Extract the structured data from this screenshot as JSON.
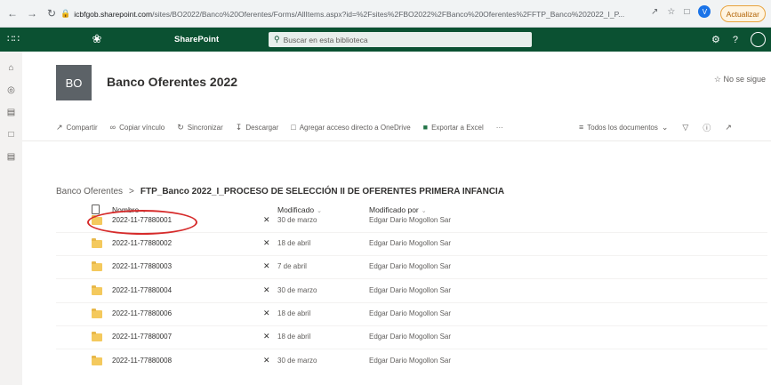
{
  "browser": {
    "url_host": "icbfgob.sharepoint.com",
    "url_path": "/sites/BO2022/Banco%20Oferentes/Forms/AllItems.aspx?id=%2Fsites%2FBO2022%2FBanco%20Oferentes%2FFTP_Banco%202022_I_P...",
    "profile_initial": "V",
    "update_label": "Actualizar"
  },
  "suite": {
    "app_name": "SharePoint",
    "search_placeholder": "Buscar en esta biblioteca",
    "help_label": "?"
  },
  "site": {
    "logo_text": "BO",
    "title": "Banco Oferentes 2022",
    "follow_label": "No se sigue"
  },
  "commands": {
    "share": "Compartir",
    "copy_link": "Copiar vínculo",
    "sync": "Sincronizar",
    "download": "Descargar",
    "add_shortcut": "Agregar acceso directo a OneDrive",
    "export_excel": "Exportar a Excel",
    "more": "···",
    "view_name": "Todos los documentos"
  },
  "breadcrumb": {
    "parent": "Banco Oferentes",
    "separator": ">",
    "current": "FTP_Banco 2022_I_PROCESO DE SELECCIÓN II DE OFERENTES PRIMERA INFANCIA"
  },
  "table": {
    "columns": {
      "name": "Nombre",
      "modified": "Modificado",
      "modified_by": "Modificado por"
    },
    "rows": [
      {
        "name": "2022-11-77880001",
        "modified": "30 de marzo",
        "modified_by": "Edgar Dario Mogollon Sar"
      },
      {
        "name": "2022-11-77880002",
        "modified": "18 de abril",
        "modified_by": "Edgar Dario Mogollon Sar"
      },
      {
        "name": "2022-11-77880003",
        "modified": "7 de abril",
        "modified_by": "Edgar Dario Mogollon Sar"
      },
      {
        "name": "2022-11-77880004",
        "modified": "30 de marzo",
        "modified_by": "Edgar Dario Mogollon Sar"
      },
      {
        "name": "2022-11-77880006",
        "modified": "18 de abril",
        "modified_by": "Edgar Dario Mogollon Sar"
      },
      {
        "name": "2022-11-77880007",
        "modified": "18 de abril",
        "modified_by": "Edgar Dario Mogollon Sar"
      },
      {
        "name": "2022-11-77880008",
        "modified": "30 de marzo",
        "modified_by": "Edgar Dario Mogollon Sar"
      }
    ]
  },
  "colors": {
    "suite_bar": "#0b5132",
    "annotation": "#d62b2b",
    "folder": "#f4c95d"
  }
}
